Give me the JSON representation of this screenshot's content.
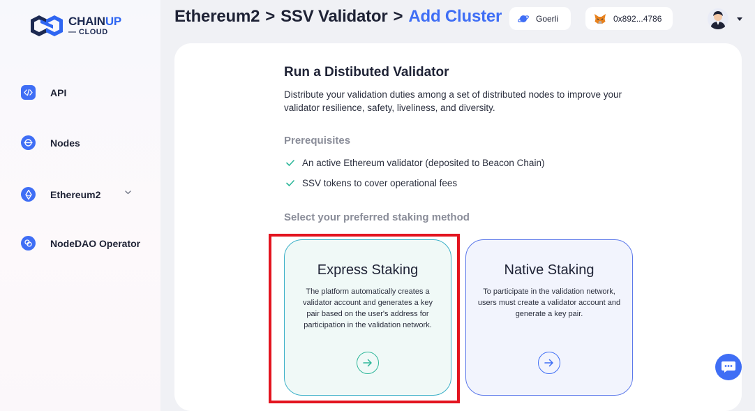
{
  "brand": {
    "name_part1": "CHAIN",
    "name_part2": "UP",
    "sub": "— CLOUD"
  },
  "sidebar": {
    "items": [
      {
        "label": "API",
        "icon": "code-icon"
      },
      {
        "label": "Nodes",
        "icon": "nodes-icon"
      },
      {
        "label": "Ethereum2",
        "icon": "ethereum-icon",
        "expandable": true
      },
      {
        "label": "NodeDAO Operator",
        "icon": "link-icon"
      }
    ]
  },
  "header": {
    "breadcrumb": [
      "Ethereum2",
      "SSV Validator",
      "Add Cluster"
    ],
    "separator": ">",
    "network": "Goerli",
    "wallet": "0x892...4786"
  },
  "main": {
    "title": "Run a Distibuted Validator",
    "description": "Distribute your validation duties among a set of distributed nodes to improve your validator resilience, safety, liveliness, and diversity.",
    "prereq_title": "Prerequisites",
    "prereqs": [
      "An active Ethereum validator (deposited to Beacon Chain)",
      "SSV tokens to cover operational fees"
    ],
    "method_title": "Select your preferred staking method",
    "options": [
      {
        "title": "Express Staking",
        "desc": "The platform automatically creates a validator account and generates a key pair based on the user's address for participation in the validation network."
      },
      {
        "title": "Native Staking",
        "desc": "To participate in the validation network, users must create a validator account and generate a key pair."
      }
    ]
  },
  "colors": {
    "accent": "#3f6ef5",
    "express_accent": "#2fb79a",
    "highlight": "#e3141f"
  }
}
